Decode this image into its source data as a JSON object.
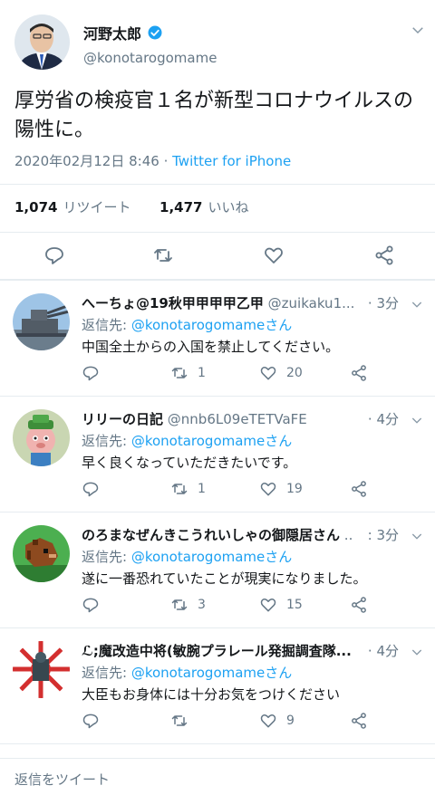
{
  "main": {
    "name": "河野太郎",
    "handle": "@konotarogomame",
    "text": "厚労省の検疫官１名が新型コロナウイルスの陽性に。",
    "date": "2020年02月12日 8:46",
    "separator": " · ",
    "source": "Twitter for iPhone",
    "retweet_count": "1,074",
    "retweet_label": "リツイート",
    "like_count": "1,477",
    "like_label": "いいね"
  },
  "replies": [
    {
      "name": "へーちょ@19秋甲甲甲甲乙甲",
      "handle": "@zuikaku1...",
      "time": "· 3分",
      "to_label": "返信先: ",
      "to": "@konotarogomameさん",
      "text": "中国全土からの入国を禁止してください。",
      "retweets": "1",
      "likes": "20"
    },
    {
      "name": "リリーの日記",
      "handle": "@nnb6L09eTETVaFE",
      "time": "· 4分",
      "to_label": "返信先: ",
      "to": "@konotarogomameさん",
      "text": "早く良くなっていただきたいです。",
      "retweets": "1",
      "likes": "19"
    },
    {
      "name": "のろまなぜんきこうれいしゃの御隠居さん",
      "handle": "...",
      "time": ": 3分",
      "to_label": "返信先: ",
      "to": "@konotarogomameさん",
      "text": "遂に一番恐れていたことが現実になりました。",
      "retweets": "3",
      "likes": "15"
    },
    {
      "name": "ℒ;魔改造中将(敏腕プラレール発掘調査隊...",
      "handle": "",
      "time": "· 4分",
      "to_label": "返信先: ",
      "to": "@konotarogomameさん",
      "text": "大臣もお身体には十分お気をつけください",
      "retweets": "",
      "likes": "9"
    }
  ],
  "footer": {
    "label": "返信をツイート"
  },
  "colors": {
    "accent": "#1da1f2",
    "muted": "#657786",
    "text": "#14171a",
    "divider": "#e6ecf0"
  }
}
